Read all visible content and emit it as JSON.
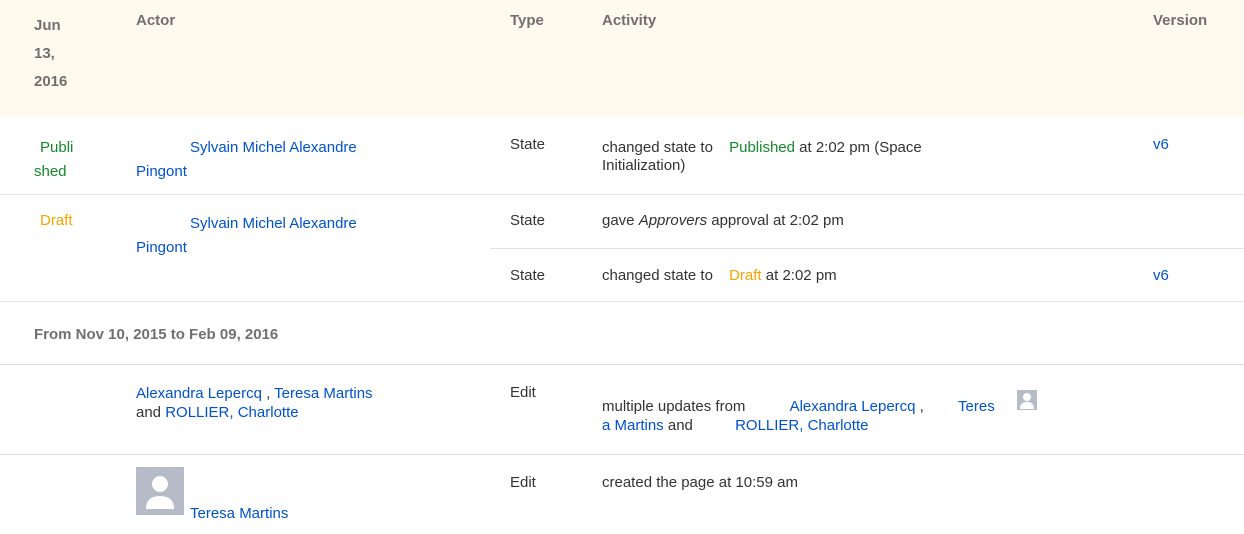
{
  "header": {
    "date": "Jun 13, 2016",
    "date_line1": "Jun",
    "date_line2": "13,",
    "date_line3": "2016",
    "actor": "Actor",
    "type": "Type",
    "activity": "Activity",
    "version": "Version"
  },
  "rows": [
    {
      "status_line1": "Publi",
      "status_line2": "shed",
      "actor_line1": "Sylvain Michel Alexandre",
      "actor_line2": "Pingont",
      "type": "State",
      "activity_pre": "changed state to",
      "activity_state": "Published",
      "activity_post": "at 2:02 pm (Space",
      "activity_post2": "Initialization)",
      "version": "v6"
    },
    {
      "status": "Draft",
      "actor_line1": "Sylvain Michel Alexandre",
      "actor_line2": "Pingont",
      "entries": [
        {
          "type": "State",
          "activity_pre": "gave",
          "activity_em": "Approvers",
          "activity_post": "approval at 2:02 pm"
        },
        {
          "type": "State",
          "activity_pre": "changed state to",
          "activity_state": "Draft",
          "activity_post": "at 2:02 pm",
          "version": "v6"
        }
      ]
    }
  ],
  "section2": {
    "title": "From Nov 10, 2015 to Feb 09, 2016",
    "rows": [
      {
        "actor_a": "Alexandra Lepercq",
        "sep": ",",
        "actor_b": "Teresa Martins",
        "and": "and",
        "actor_c": "ROLLIER, Charlotte",
        "type": "Edit",
        "activity_pre": "multiple updates from",
        "activity_a": "Alexandra Lepercq",
        "activity_sep": ",",
        "activity_b_line1": "Teres",
        "activity_b_line2": "a Martins",
        "activity_and": "and",
        "activity_c": "ROLLIER, Charlotte"
      },
      {
        "actor": "Teresa Martins",
        "type": "Edit",
        "activity": "created the page at 10:59 am"
      }
    ]
  },
  "colors": {
    "header_bg": "#fffaed",
    "link": "#0052cc",
    "published": "#14892c",
    "draft": "#f6a400"
  }
}
